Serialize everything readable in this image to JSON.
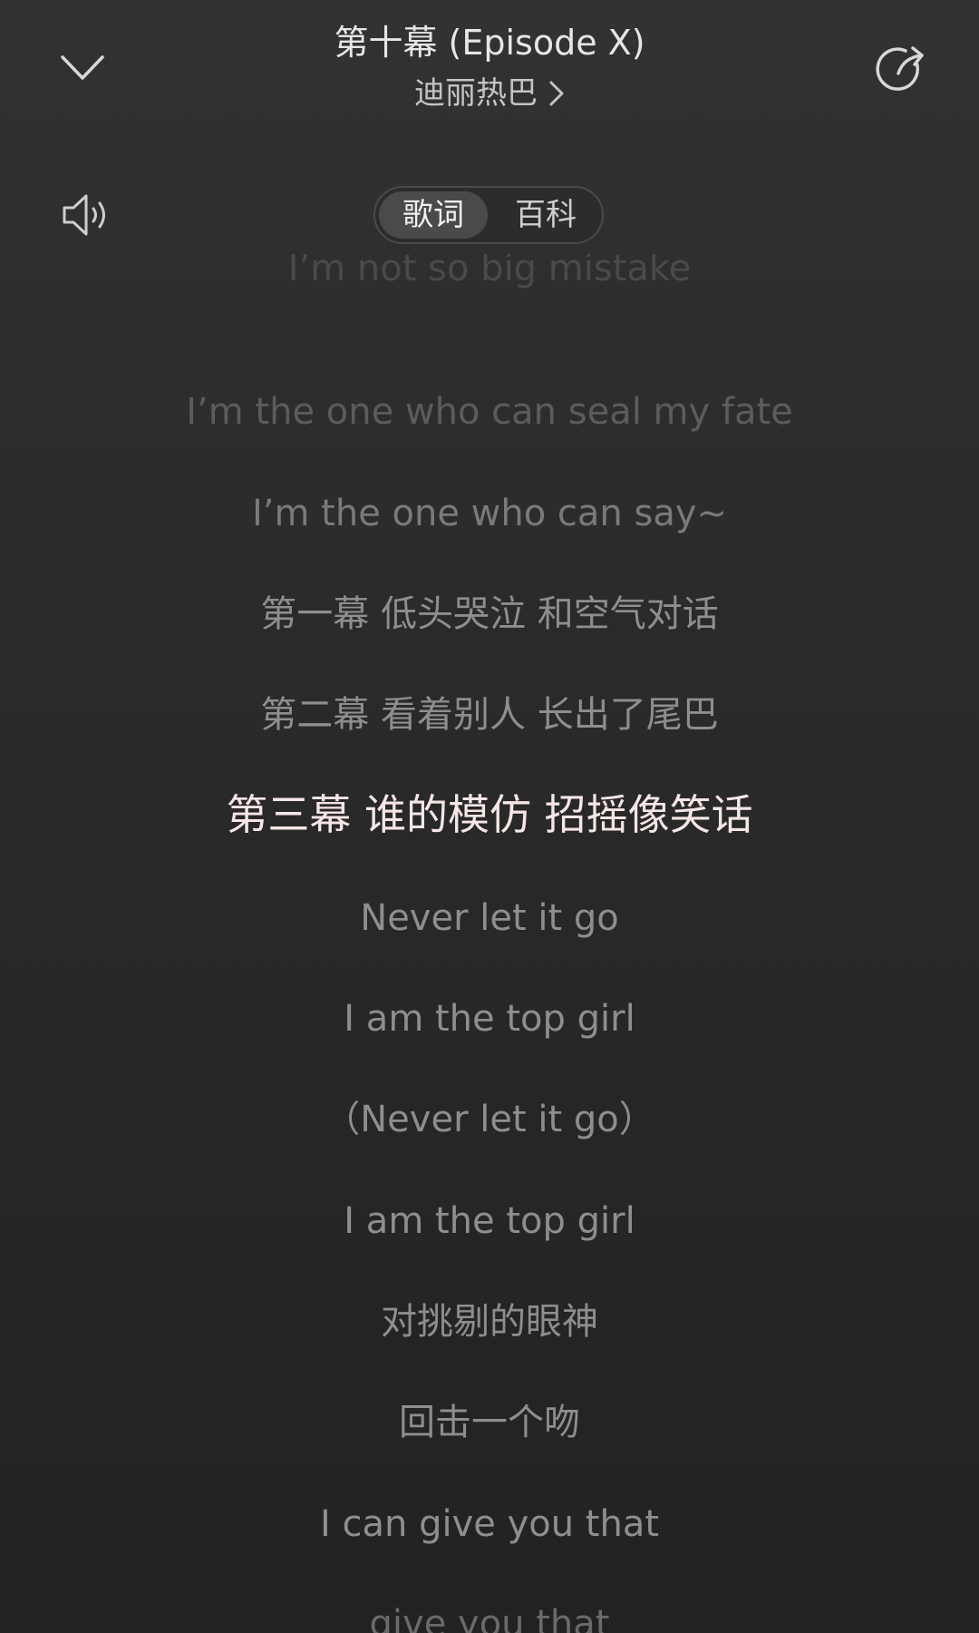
{
  "header": {
    "title": "第十幕 (Episode X)",
    "artist": "迪丽热巴",
    "collapse_icon": "chevron-down-icon",
    "share_icon": "share-icon"
  },
  "controls": {
    "volume_icon": "speaker-icon",
    "tabs": [
      {
        "label": "歌词",
        "active": true
      },
      {
        "label": "百科",
        "active": false
      }
    ]
  },
  "lyrics": {
    "current_index": 5,
    "lines": [
      "I’m not so big mistake",
      "I’m the one who can seal my fate",
      "I’m the one who can say~",
      "第一幕 低头哭泣 和空气对话",
      "第二幕 看着别人 长出了尾巴",
      "第三幕 谁的模仿 招摇像笑话",
      "Never let it go",
      "I am the top girl",
      "（Never let it go）",
      "I am the top girl",
      "对挑剔的眼神",
      "回击一个吻",
      "I can give you that",
      "give you that"
    ]
  },
  "colors": {
    "background": "#2a2a2a",
    "current_line": "#f6e6e6",
    "normal_line": "#8e8e8e"
  }
}
